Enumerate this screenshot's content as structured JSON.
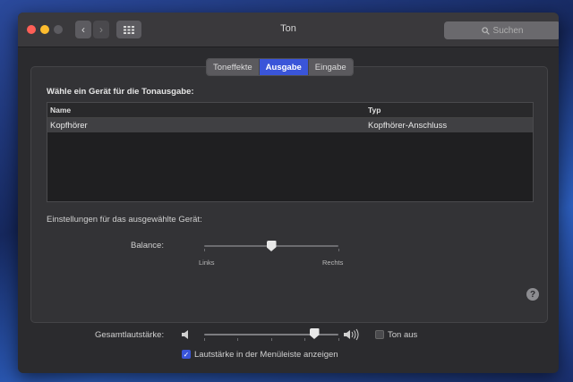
{
  "window": {
    "title": "Ton",
    "search_placeholder": "Suchen",
    "traffic_lights": {
      "close": "#ff5f57",
      "minimize": "#febc2e",
      "zoom": "#5c5b60"
    }
  },
  "tabs": [
    {
      "label": "Toneffekte",
      "active": false
    },
    {
      "label": "Ausgabe",
      "active": true
    },
    {
      "label": "Eingabe",
      "active": false
    }
  ],
  "output": {
    "section_title": "Wähle ein Gerät für die Tonausgabe:",
    "columns": [
      "Name",
      "Typ"
    ],
    "devices": [
      {
        "name": "Kopfhörer",
        "type": "Kopfhörer-Anschluss",
        "selected": true
      }
    ]
  },
  "device_settings": {
    "title": "Einstellungen für das ausgewählte Gerät:",
    "balance_label": "Balance:",
    "balance_left": "Links",
    "balance_right": "Rechts",
    "balance_value": 0.5
  },
  "volume": {
    "label": "Gesamtlautstärke:",
    "value": 0.82,
    "mute_label": "Ton aus",
    "mute_checked": false,
    "menubar_label": "Lautstärke in der Menüleiste anzeigen",
    "menubar_checked": true
  },
  "icons": {
    "back": "chevron-left-icon",
    "forward": "chevron-right-icon",
    "grid": "grid-icon",
    "search": "search-icon",
    "help": "help-icon",
    "speaker_low": "speaker-low-icon",
    "speaker_high": "speaker-high-icon"
  },
  "colors": {
    "accent": "#3a55d9"
  }
}
